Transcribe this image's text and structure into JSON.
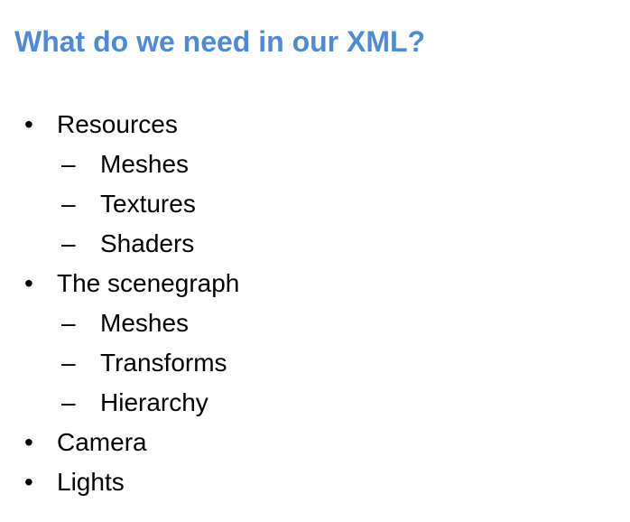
{
  "slide": {
    "title": "What do we need in our XML?",
    "title_color": "#4f8ad6",
    "bullet_marker": "•",
    "sub_bullet_marker": "–",
    "items": [
      {
        "level": 1,
        "text": "Resources"
      },
      {
        "level": 2,
        "text": "Meshes"
      },
      {
        "level": 2,
        "text": "Textures"
      },
      {
        "level": 2,
        "text": "Shaders"
      },
      {
        "level": 1,
        "text": "The scenegraph"
      },
      {
        "level": 2,
        "text": "Meshes"
      },
      {
        "level": 2,
        "text": "Transforms"
      },
      {
        "level": 2,
        "text": "Hierarchy"
      },
      {
        "level": 1,
        "text": "Camera"
      },
      {
        "level": 1,
        "text": "Lights"
      }
    ]
  }
}
